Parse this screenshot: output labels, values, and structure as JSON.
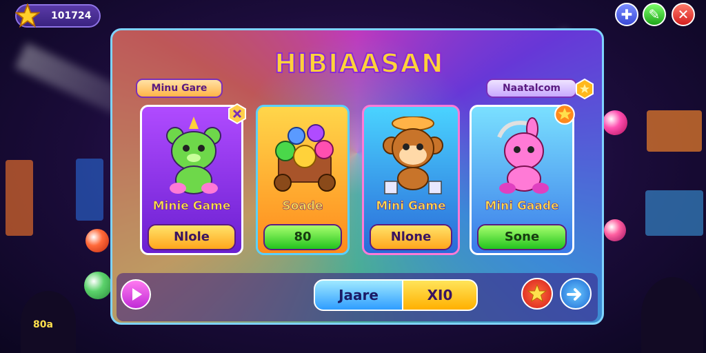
{
  "hud": {
    "currency_value": "101724"
  },
  "top_buttons": [
    {
      "icon": "plus-icon"
    },
    {
      "icon": "edit-icon"
    },
    {
      "icon": "close-icon"
    }
  ],
  "panel": {
    "title": "HIBIAASAN",
    "left_tab": "Minu Gare",
    "right_tab": "Naatalcom"
  },
  "cards": [
    {
      "label": "Minie Game",
      "button": "Nlole",
      "button_color": "orange",
      "icon": "green-bear-icon"
    },
    {
      "label": "Soade",
      "button": "80",
      "button_color": "green",
      "icon": "candy-pile-icon"
    },
    {
      "label": "Mini Game",
      "button": "Nlone",
      "button_color": "orange",
      "icon": "monkey-icon"
    },
    {
      "label": "Mini Gaade",
      "button": "Sone",
      "button_color": "green",
      "icon": "pink-bunny-icon"
    }
  ],
  "bottom": {
    "segment_left": "Jaare",
    "segment_right": "XI0",
    "corner_text": "80a"
  },
  "colors": {
    "accent_orange": "#ffa61c",
    "accent_green": "#22c41e",
    "title_yellow": "#ffd23a",
    "purple": "#7a2fb8"
  }
}
